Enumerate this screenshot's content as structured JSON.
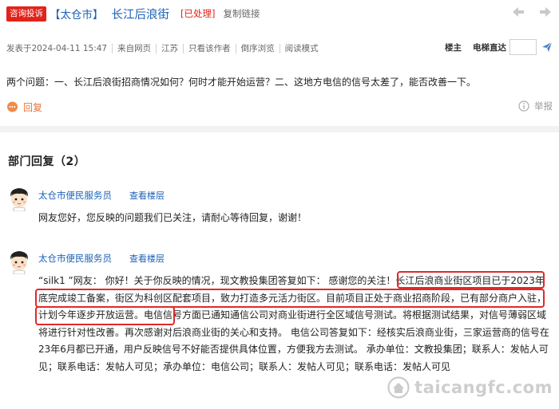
{
  "header": {
    "consult_tag": "咨询投诉",
    "city_tag": "【太仓市】",
    "title": "长江后浪街",
    "status_tag": "[已处理]",
    "copy_link": "复制链接"
  },
  "meta": {
    "posted_at": "发表于2024-04-11 15:47",
    "source": "来自网页",
    "region": "江苏",
    "author_only": "只看该作者",
    "reverse_order": "倒序浏览",
    "reading_mode": "阅读模式",
    "floor_owner": "楼主",
    "elevator": "电梯直达",
    "floor_input_value": ""
  },
  "question": {
    "text": "两个问题：一、长江后浪街招商情况如何？何时才能开始运营？二、这地方电信的信号太差了，能否改善一下。"
  },
  "actions": {
    "reply_label": "回复",
    "report_label": "举报"
  },
  "department": {
    "title": "部门回复（2）"
  },
  "replies": [
    {
      "name": "太仓市便民服务员",
      "view_floor": "查看楼层",
      "text": "网友您好，您反映的问题我们已关注，请耐心等待回复，谢谢！"
    },
    {
      "name": "太仓市便民服务员",
      "view_floor": "查看楼层",
      "text": "“silk1 ”网友： 你好！关于你反映的情况，现文教投集团答复如下： 感谢您的关注！长江后浪商业街区项目已于2023年底完成竣工备案，街区为科创区配套项目，致力打造多元活力街区。目前项目正处于商业招商阶段，已有部分商户入驻，计划今年逐步开放运营。电信信号方面已通知通信公司对商业街进行全区域信号测试。将根据测试结果，对信号薄弱区域将进行针对性改善。再次感谢对后浪商业街的关心和支持。 电信公司答复如下：经核实后浪商业街，三家运营商的信号在23年6月都已开通，用户反映信号不好能否提供具体位置，方便我方去测试。 承办单位：文教投集团；联系人：发帖人可见；联系电话：发帖人可见；承办单位：电信公司；联系人：发帖人可见；联系电话：发帖人可见"
    }
  ],
  "watermark": {
    "text": "taicangfc.com"
  },
  "colors": {
    "accent_blue": "#1d62b7",
    "alert_red": "#e2231a",
    "reply_orange": "#e8773b",
    "highlight_red": "#e0292b"
  },
  "icons": {
    "prev": "arrow-left-icon",
    "next": "arrow-right-icon",
    "jump": "paper-plane-icon",
    "reply": "chat-bubble-icon",
    "report": "info-circle-icon",
    "avatar": "cartoon-avatar-icon",
    "watermark_logo": "house-logo-icon"
  }
}
